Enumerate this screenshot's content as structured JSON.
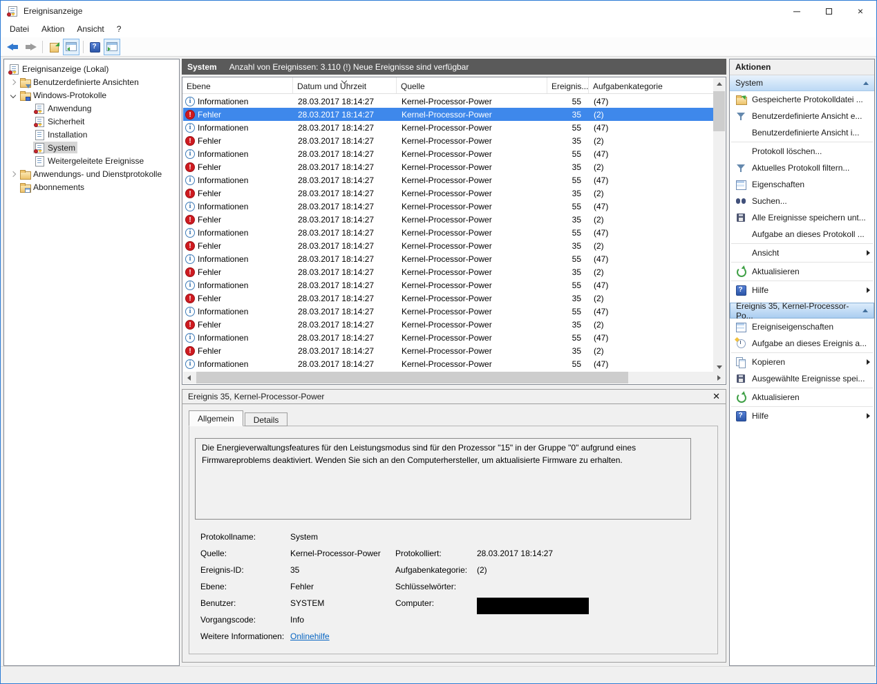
{
  "window": {
    "title": "Ereignisanzeige",
    "controls": [
      "minimize",
      "maximize",
      "close"
    ]
  },
  "menu": {
    "items": [
      "Datei",
      "Aktion",
      "Ansicht",
      "?"
    ]
  },
  "toolbar": {
    "buttons": [
      "back",
      "forward",
      "export-log",
      "toggle-console-tree",
      "help",
      "toggle-action-pane"
    ]
  },
  "sidebar": {
    "items": [
      {
        "label": "Ereignisanzeige (Lokal)",
        "pad": 5,
        "exp": "none",
        "icon": "applog",
        "selected": false
      },
      {
        "label": "Benutzerdefinierte Ansichten",
        "pad": 5,
        "exp": "collapsed",
        "icon": "folder-filter",
        "selected": false
      },
      {
        "label": "Windows-Protokolle",
        "pad": 5,
        "exp": "expanded",
        "icon": "folder-windows",
        "selected": false
      },
      {
        "label": "Anwendung",
        "pad": 42,
        "exp": "none",
        "icon": "log",
        "selected": false
      },
      {
        "label": "Sicherheit",
        "pad": 42,
        "exp": "none",
        "icon": "log",
        "selected": false
      },
      {
        "label": "Installation",
        "pad": 42,
        "exp": "none",
        "icon": "logplain",
        "selected": false
      },
      {
        "label": "System",
        "pad": 42,
        "exp": "none",
        "icon": "log",
        "selected": true
      },
      {
        "label": "Weitergeleitete Ereignisse",
        "pad": 42,
        "exp": "none",
        "icon": "logplain",
        "selected": false
      },
      {
        "label": "Anwendungs- und Dienstprotokolle",
        "pad": 5,
        "exp": "collapsed",
        "icon": "folder",
        "selected": false
      },
      {
        "label": "Abonnements",
        "pad": 21,
        "exp": "none",
        "icon": "folder-table",
        "selected": false
      }
    ]
  },
  "events_header": {
    "log": "System",
    "summary": "Anzahl von Ereignissen: 3.110 (!) Neue Ereignisse sind verfügbar"
  },
  "table": {
    "columns": [
      "Ebene",
      "Datum und Uhrzeit",
      "Quelle",
      "Ereignis...",
      "Aufgabenkategorie"
    ],
    "sorted_column": "Datum und Uhrzeit",
    "rows": [
      {
        "level": "Informationen",
        "date": "28.03.2017 18:14:27",
        "source": "Kernel-Processor-Power",
        "id": "55",
        "cat": "(47)",
        "selected": false
      },
      {
        "level": "Fehler",
        "date": "28.03.2017 18:14:27",
        "source": "Kernel-Processor-Power",
        "id": "35",
        "cat": "(2)",
        "selected": true
      },
      {
        "level": "Informationen",
        "date": "28.03.2017 18:14:27",
        "source": "Kernel-Processor-Power",
        "id": "55",
        "cat": "(47)",
        "selected": false
      },
      {
        "level": "Fehler",
        "date": "28.03.2017 18:14:27",
        "source": "Kernel-Processor-Power",
        "id": "35",
        "cat": "(2)",
        "selected": false
      },
      {
        "level": "Informationen",
        "date": "28.03.2017 18:14:27",
        "source": "Kernel-Processor-Power",
        "id": "55",
        "cat": "(47)",
        "selected": false
      },
      {
        "level": "Fehler",
        "date": "28.03.2017 18:14:27",
        "source": "Kernel-Processor-Power",
        "id": "35",
        "cat": "(2)",
        "selected": false
      },
      {
        "level": "Informationen",
        "date": "28.03.2017 18:14:27",
        "source": "Kernel-Processor-Power",
        "id": "55",
        "cat": "(47)",
        "selected": false
      },
      {
        "level": "Fehler",
        "date": "28.03.2017 18:14:27",
        "source": "Kernel-Processor-Power",
        "id": "35",
        "cat": "(2)",
        "selected": false
      },
      {
        "level": "Informationen",
        "date": "28.03.2017 18:14:27",
        "source": "Kernel-Processor-Power",
        "id": "55",
        "cat": "(47)",
        "selected": false
      },
      {
        "level": "Fehler",
        "date": "28.03.2017 18:14:27",
        "source": "Kernel-Processor-Power",
        "id": "35",
        "cat": "(2)",
        "selected": false
      },
      {
        "level": "Informationen",
        "date": "28.03.2017 18:14:27",
        "source": "Kernel-Processor-Power",
        "id": "55",
        "cat": "(47)",
        "selected": false
      },
      {
        "level": "Fehler",
        "date": "28.03.2017 18:14:27",
        "source": "Kernel-Processor-Power",
        "id": "35",
        "cat": "(2)",
        "selected": false
      },
      {
        "level": "Informationen",
        "date": "28.03.2017 18:14:27",
        "source": "Kernel-Processor-Power",
        "id": "55",
        "cat": "(47)",
        "selected": false
      },
      {
        "level": "Fehler",
        "date": "28.03.2017 18:14:27",
        "source": "Kernel-Processor-Power",
        "id": "35",
        "cat": "(2)",
        "selected": false
      },
      {
        "level": "Informationen",
        "date": "28.03.2017 18:14:27",
        "source": "Kernel-Processor-Power",
        "id": "55",
        "cat": "(47)",
        "selected": false
      },
      {
        "level": "Fehler",
        "date": "28.03.2017 18:14:27",
        "source": "Kernel-Processor-Power",
        "id": "35",
        "cat": "(2)",
        "selected": false
      },
      {
        "level": "Informationen",
        "date": "28.03.2017 18:14:27",
        "source": "Kernel-Processor-Power",
        "id": "55",
        "cat": "(47)",
        "selected": false
      },
      {
        "level": "Fehler",
        "date": "28.03.2017 18:14:27",
        "source": "Kernel-Processor-Power",
        "id": "35",
        "cat": "(2)",
        "selected": false
      },
      {
        "level": "Informationen",
        "date": "28.03.2017 18:14:27",
        "source": "Kernel-Processor-Power",
        "id": "55",
        "cat": "(47)",
        "selected": false
      },
      {
        "level": "Fehler",
        "date": "28.03.2017 18:14:27",
        "source": "Kernel-Processor-Power",
        "id": "35",
        "cat": "(2)",
        "selected": false
      },
      {
        "level": "Informationen",
        "date": "28.03.2017 18:14:27",
        "source": "Kernel-Processor-Power",
        "id": "55",
        "cat": "(47)",
        "selected": false
      }
    ]
  },
  "detail": {
    "title": "Ereignis 35, Kernel-Processor-Power",
    "tabs": [
      "Allgemein",
      "Details"
    ],
    "active_tab": "Allgemein",
    "description": "Die Energieverwaltungsfeatures für den Leistungsmodus sind für den Prozessor \"15\" in der Gruppe \"0\" aufgrund eines Firmwareproblems deaktiviert. Wenden Sie sich an den Computerhersteller, um aktualisierte Firmware zu erhalten.",
    "fields": [
      {
        "l1": "Protokollname:",
        "v1": "System",
        "l2": "",
        "v2": ""
      },
      {
        "l1": "Quelle:",
        "v1": "Kernel-Processor-Power",
        "l2": "Protokolliert:",
        "v2": "28.03.2017 18:14:27"
      },
      {
        "l1": "Ereignis-ID:",
        "v1": "35",
        "l2": "Aufgabenkategorie:",
        "v2": "(2)"
      },
      {
        "l1": "Ebene:",
        "v1": "Fehler",
        "l2": "Schlüsselwörter:",
        "v2": ""
      },
      {
        "l1": "Benutzer:",
        "v1": "SYSTEM",
        "l2": "Computer:",
        "v2": "",
        "v2_redacted": true
      },
      {
        "l1": "Vorgangscode:",
        "v1": "Info",
        "l2": "",
        "v2": ""
      },
      {
        "l1": "Weitere Informationen:",
        "v1": "Onlinehilfe",
        "v1_link": true,
        "l2": "",
        "v2": ""
      }
    ]
  },
  "actions": {
    "title": "Aktionen",
    "sections": [
      {
        "title": "System",
        "active": false,
        "items": [
          {
            "label": "Gespeicherte Protokolldatei ...",
            "icon": "open-folder",
            "arrow": false,
            "sep_after": false
          },
          {
            "label": "Benutzerdefinierte Ansicht e...",
            "icon": "filter",
            "arrow": false,
            "sep_after": false
          },
          {
            "label": "Benutzerdefinierte Ansicht i...",
            "icon": null,
            "arrow": false,
            "sep_after": true
          },
          {
            "label": "Protokoll löschen...",
            "icon": null,
            "arrow": false,
            "sep_after": false
          },
          {
            "label": "Aktuelles Protokoll filtern...",
            "icon": "filter",
            "arrow": false,
            "sep_after": false
          },
          {
            "label": "Eigenschaften",
            "icon": "props",
            "arrow": false,
            "sep_after": false
          },
          {
            "label": "Suchen...",
            "icon": "binoc",
            "arrow": false,
            "sep_after": false
          },
          {
            "label": "Alle Ereignisse speichern unt...",
            "icon": "save",
            "arrow": false,
            "sep_after": false
          },
          {
            "label": "Aufgabe an dieses Protokoll ...",
            "icon": null,
            "arrow": false,
            "sep_after": true
          },
          {
            "label": "Ansicht",
            "icon": null,
            "arrow": true,
            "sep_after": true
          },
          {
            "label": "Aktualisieren",
            "icon": "refresh",
            "arrow": false,
            "sep_after": true
          },
          {
            "label": "Hilfe",
            "icon": "help",
            "arrow": true,
            "sep_after": false
          }
        ]
      },
      {
        "title": "Ereignis 35, Kernel-Processor-Po...",
        "active": true,
        "items": [
          {
            "label": "Ereigniseigenschaften",
            "icon": "props",
            "arrow": false,
            "sep_after": false
          },
          {
            "label": "Aufgabe an dieses Ereignis a...",
            "icon": "task",
            "arrow": false,
            "sep_after": true
          },
          {
            "label": "Kopieren",
            "icon": "copy",
            "arrow": true,
            "sep_after": false
          },
          {
            "label": "Ausgewählte Ereignisse spei...",
            "icon": "save",
            "arrow": false,
            "sep_after": true
          },
          {
            "label": "Aktualisieren",
            "icon": "refresh",
            "arrow": false,
            "sep_after": true
          },
          {
            "label": "Hilfe",
            "icon": "help",
            "arrow": true,
            "sep_after": false
          }
        ]
      }
    ]
  }
}
